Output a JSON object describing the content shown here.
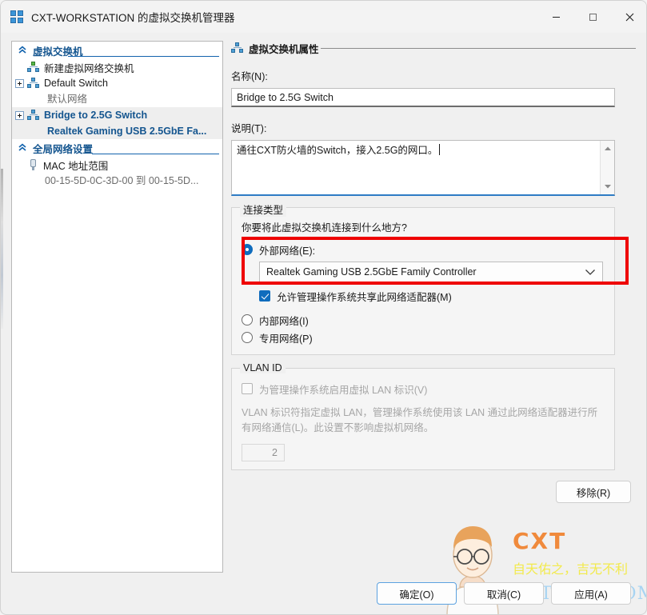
{
  "window": {
    "title": "CXT-WORKSTATION 的虚拟交换机管理器",
    "icon": "virtual-switch-icon",
    "controls": {
      "minimize": "minimize-icon",
      "maximize": "maximize-icon",
      "close": "close-icon"
    }
  },
  "sidebar": {
    "groups": [
      {
        "label": "虚拟交换机",
        "items": [
          {
            "label": "新建虚拟网络交换机",
            "icon": "add-switch-icon",
            "expandable": false,
            "selected": false,
            "sub": null
          },
          {
            "label": "Default Switch",
            "icon": "switch-icon",
            "expandable": true,
            "selected": false,
            "sub": "默认网络"
          },
          {
            "label": "Bridge to 2.5G Switch",
            "icon": "switch-icon",
            "expandable": true,
            "selected": true,
            "sub": "Realtek Gaming USB 2.5GbE Fa..."
          }
        ]
      },
      {
        "label": "全局网络设置",
        "items": [
          {
            "label": "MAC 地址范围",
            "icon": "mac-range-icon",
            "expandable": false,
            "selected": false,
            "sub": "00-15-5D-0C-3D-00 到 00-15-5D..."
          }
        ]
      }
    ]
  },
  "main": {
    "header": "虚拟交换机属性",
    "header_icon": "switch-icon",
    "name_label": "名称(N):",
    "name_value": "Bridge to 2.5G Switch",
    "desc_label": "说明(T):",
    "desc_value": "通往CXT防火墙的Switch，接入2.5G的网口。",
    "connection": {
      "title": "连接类型",
      "hint": "你要将此虚拟交换机连接到什么地方?",
      "options": [
        {
          "label": "外部网络(E):",
          "selected": true
        },
        {
          "label": "内部网络(I)",
          "selected": false
        },
        {
          "label": "专用网络(P)",
          "selected": false
        }
      ],
      "adapter_value": "Realtek Gaming USB 2.5GbE Family Controller",
      "adapter_chevron": "chevron-down-icon",
      "share_checkbox": {
        "label": "允许管理操作系统共享此网络适配器(M)",
        "checked": true
      }
    },
    "vlan": {
      "title": "VLAN ID",
      "enable_checkbox": {
        "label": "为管理操作系统启用虚拟 LAN 标识(V)",
        "checked": false
      },
      "description": "VLAN 标识符指定虚拟 LAN，管理操作系统使用该 LAN 通过此网络适配器进行所有网络通信(L)。此设置不影响虚拟机网络。",
      "id_value": "2"
    },
    "remove_label": "移除(R)"
  },
  "footer": {
    "ok_label": "确定(O)",
    "cancel_label": "取消(C)",
    "apply_label": "应用(A)"
  },
  "watermark": {
    "brand": "CXT",
    "slogan": "自天佑之，吉无不利",
    "domain": "CXTHHH.COM"
  },
  "colors": {
    "accent": "#0f6cbd",
    "highlight_box": "#ee0000",
    "tree_group": "#14558f",
    "brand_orange": "#f08a3c",
    "slogan_yellow": "#f2ea4c",
    "domain_blue": "#a8d4f2"
  }
}
